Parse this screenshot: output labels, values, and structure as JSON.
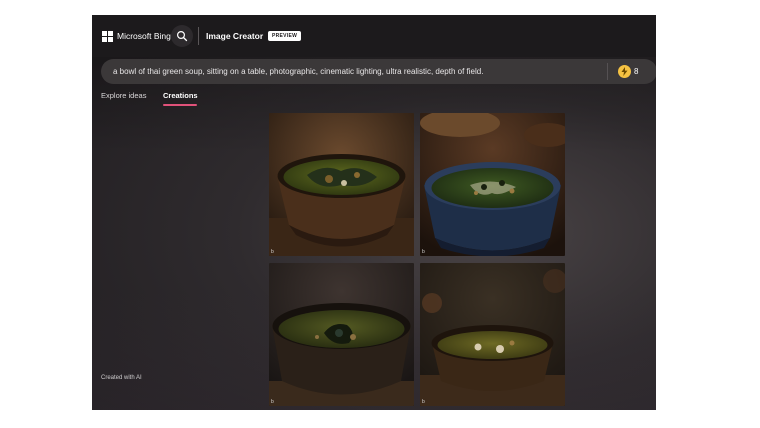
{
  "header": {
    "brand": "Microsoft Bing",
    "app_title": "Image Creator",
    "badge": "PREVIEW"
  },
  "prompt": {
    "text": "a bowl of thai green soup, sitting on a table, photographic, cinematic lighting, ultra realistic, depth of field.",
    "boosts": "8"
  },
  "tabs": {
    "explore": "Explore ideas",
    "creations": "Creations",
    "active": "Creations"
  },
  "images": [
    {
      "badge": "b",
      "subject": "bowl of thai green soup"
    },
    {
      "badge": "b",
      "subject": "bowl of thai green soup"
    },
    {
      "badge": "b",
      "subject": "bowl of thai green soup"
    },
    {
      "badge": "b",
      "subject": "bowl of thai green soup"
    }
  ],
  "footer": {
    "note": "Created with AI"
  },
  "colors": {
    "accent_underline": "#e0527a",
    "boost_icon": "#f5c242",
    "header_bg": "#1c1a1c"
  }
}
